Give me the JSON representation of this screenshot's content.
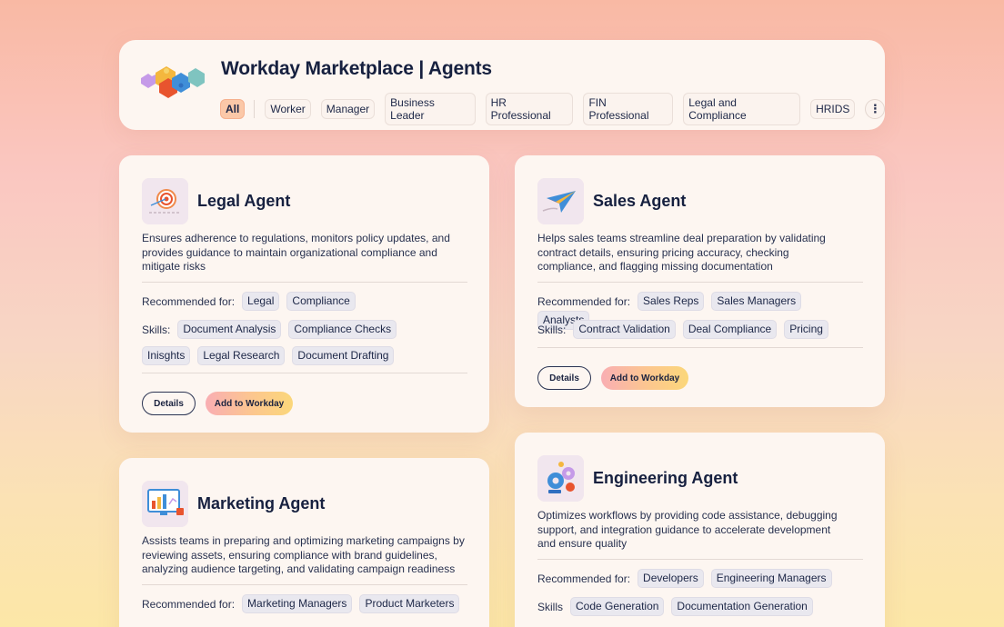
{
  "header": {
    "title": "Workday Marketplace | Agents",
    "tabs": [
      "All",
      "Worker",
      "Manager",
      "Business Leader",
      "HR Professional",
      "FIN Professional",
      "Legal and Compliance",
      "HRIDS"
    ],
    "active_tab": "All",
    "more_label": "⋮"
  },
  "cards": [
    {
      "title": "Legal Agent",
      "description": "Ensures adherence to regulations, monitors policy updates, and provides guidance to maintain organizational compliance and mitigate risks",
      "recommended_label": "Recommended for:",
      "recommended": [
        "Legal",
        "Compliance"
      ],
      "skills_label": "Skills:",
      "skills": [
        "Document Analysis",
        "Compliance Checks",
        "Inisghts",
        "Legal Research",
        "Document Drafting"
      ],
      "details_label": "Details",
      "add_label": "Add to Workday"
    },
    {
      "title": "Sales Agent",
      "description": "Helps sales teams streamline deal preparation by validating contract details, ensuring pricing accuracy, checking compliance, and flagging missing documentation",
      "recommended_label": "Recommended for:",
      "recommended": [
        "Sales Reps",
        "Sales Managers",
        "Analysts"
      ],
      "skills_label": "Skills:",
      "skills": [
        "Contract Validation",
        "Deal Compliance",
        "Pricing"
      ],
      "details_label": "Details",
      "add_label": "Add to Workday"
    },
    {
      "title": "Marketing Agent",
      "description": "Assists teams in preparing and optimizing marketing campaigns by reviewing assets, ensuring compliance with brand guidelines, analyzing audience targeting, and validating campaign readiness",
      "recommended_label": "Recommended for:",
      "recommended": [
        "Marketing Managers",
        "Product Marketers"
      ]
    },
    {
      "title": "Engineering Agent",
      "description": "Optimizes workflows by providing code assistance, debugging support, and integration guidance to accelerate development and ensure quality",
      "recommended_label": "Recommended for:",
      "recommended": [
        "Developers",
        "Engineering Managers"
      ],
      "skills_label": "Skills",
      "skills": [
        "Code Generation",
        "Documentation Generation"
      ]
    }
  ],
  "colors": {
    "accent_tab": "#fbc8a8",
    "add_button_gradient": [
      "#f9aeb3",
      "#fcc78e",
      "#fbd77a"
    ],
    "text_primary": "#16203f"
  },
  "icons": {
    "logo": "puzzle-pieces-icon",
    "legal": "target-icon",
    "sales": "paper-plane-icon",
    "marketing": "monitor-chart-icon",
    "engineering": "gears-icon"
  }
}
